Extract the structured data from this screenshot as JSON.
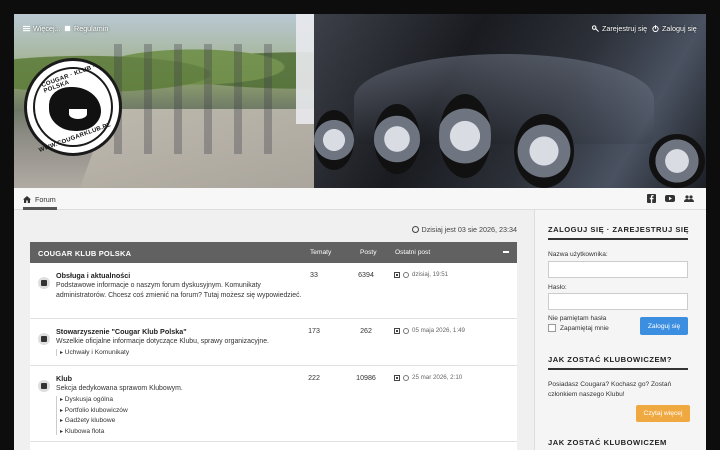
{
  "topnav": {
    "more_label": "Więcej...",
    "rules_label": "Regulamin",
    "register_label": "Zarejestruj się",
    "login_label": "Zaloguj się"
  },
  "logo": {
    "top_text": "COUGAR · KLUB · POLSKA",
    "bottom_text": "WWW.COUGARKLUB.PL"
  },
  "navbar": {
    "breadcrumb_label": "Forum",
    "social_icons": [
      "facebook-icon",
      "youtube-icon",
      "users-icon"
    ]
  },
  "datetime": "Dzisiaj jest 03 sie 2026, 23:34",
  "forum": {
    "header_title": "COUGAR KLUB POLSKA",
    "col_topics": "Tematy",
    "col_posts": "Posty",
    "col_last": "Ostatni post",
    "rows": [
      {
        "name": "Obsługa i aktualności",
        "desc": "Podstawowe informacje o naszym forum dyskusyjnym. Komunikaty administratorów. Chcesz coś zmienić na forum? Tutaj możesz się wypowiedzieć.",
        "topics": "33",
        "posts": "6394",
        "last": "dzisiaj, 19:51",
        "subforums": []
      },
      {
        "name": "Stowarzyszenie \"Cougar Klub Polska\"",
        "desc": "Wszelkie oficjalne informacje dotyczące Klubu, sprawy organizacyjne.",
        "topics": "173",
        "posts": "262",
        "last": "05 maja 2026, 1:49",
        "subforums": [
          "Uchwały i Komunikaty"
        ]
      },
      {
        "name": "Klub",
        "desc": "Sekcja dedykowana sprawom Klubowym.",
        "topics": "222",
        "posts": "10986",
        "last": "25 mar 2026, 2:10",
        "subforums": [
          "Dyskusja ogólna",
          "Portfolio klubowiczów",
          "Gadżety klubowe",
          "Klubowa flota"
        ]
      }
    ]
  },
  "sidebar": {
    "login_title": "ZALOGUJ SIĘ · ZAREJESTRUJ SIĘ",
    "username_label": "Nazwa użytkownika:",
    "password_label": "Hasło:",
    "forgot_label": "Nie pamiętam hasła",
    "remember_label": "Zapamiętaj mnie",
    "login_button": "Zaloguj się",
    "join_title": "JAK ZOSTAĆ KLUBOWICZEM?",
    "join_text": "Posiadasz Cougara? Kochasz go? Zostań członkiem naszego Klubu!",
    "join_button": "Czytaj więcej",
    "join_title_2": "JAK ZOSTAĆ KLUBOWICZEM"
  },
  "colors": {
    "forum_header": "#616161",
    "login_button": "#3c8ee0",
    "read_more_button": "#f0a940"
  }
}
